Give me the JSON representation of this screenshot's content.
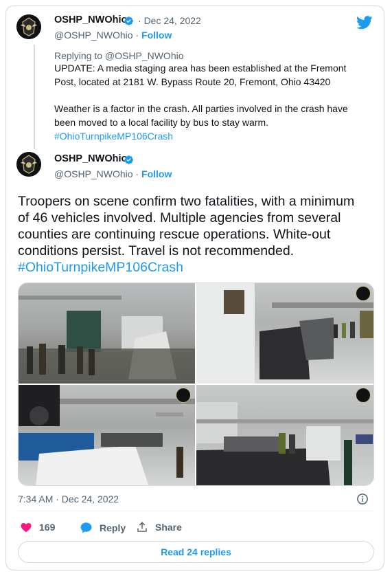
{
  "tweet_parent": {
    "display_name": "OSHP_NWOhio",
    "handle": "@OSHP_NWOhio",
    "separator": "·",
    "date": "Dec 24, 2022",
    "follow_label": "Follow",
    "replying_to": "Replying to @OSHP_NWOhio",
    "text_line1": "UPDATE: A media staging area has been established at the Fremont",
    "text_line2": "Post, located at 2181 W. Bypass Route 20, Fremont, Ohio 43420",
    "text_line3": "Weather is a factor in the crash. All parties involved in the crash have",
    "text_line4": "been moved to a local  facility by bus to stay warm.",
    "hashtag": "#OhioTurnpikeMP106Crash"
  },
  "tweet_main": {
    "display_name": "OSHP_NWOhio",
    "handle": "@OSHP_NWOhio",
    "separator": "·",
    "follow_label": "Follow",
    "text_line1": "Troopers on scene confirm two fatalities, with a minimum",
    "text_line2": "of 46 vehicles involved. Multiple agencies from several",
    "text_line3": "counties are continuing rescue operations. White-out",
    "text_line4": "conditions persist. Travel is not recommended.",
    "hashtag": "#OhioTurnpikeMP106Crash",
    "timestamp": "7:34 AM · Dec 24, 2022"
  },
  "actions": {
    "like_count": "169",
    "reply_label": "Reply",
    "share_label": "Share",
    "read_replies_label": "Read 24 replies"
  },
  "avatar_badge_text": "STATE HIGHWAY PATROL OHIO",
  "colors": {
    "accent": "#1d9bf0",
    "like": "#f91880",
    "muted": "#536471",
    "border": "#cfd9de"
  },
  "icons": [
    "twitter-bird-icon",
    "verified-badge-icon",
    "info-icon",
    "heart-icon",
    "reply-bubble-icon",
    "share-icon"
  ]
}
